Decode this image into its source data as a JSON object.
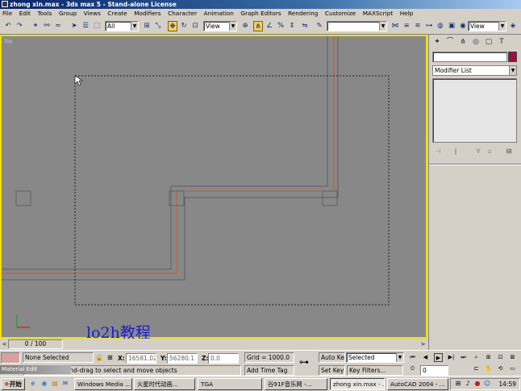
{
  "window": {
    "title": "zhong xin.max - 3ds max 5 - Stand-alone License"
  },
  "menu": {
    "items": [
      "File",
      "Edit",
      "Tools",
      "Group",
      "Views",
      "Create",
      "Modifiers",
      "Character",
      "Animation",
      "Graph Editors",
      "Rendering",
      "Customize",
      "MAXScript",
      "Help"
    ]
  },
  "toolbar": {
    "selection_filter": "All",
    "ref_coord": "View",
    "named_selection": "",
    "right_view": "View"
  },
  "viewport": {
    "label": "Top",
    "watermark": "lo2h教程",
    "border_color": "#f0e000",
    "background": "#888888"
  },
  "command_panel": {
    "object_name": "",
    "object_color": "#9a1040",
    "modifier_list": "Modifier List"
  },
  "timeline": {
    "frame_display": "0 / 100"
  },
  "status": {
    "selection": "None Selected",
    "prompt": "Click or click-and-drag to select and move objects",
    "x_label": "X:",
    "x_value": "16581.02",
    "y_label": "Y:",
    "y_value": "56280.1",
    "z_label": "Z:",
    "z_value": "0.0",
    "grid": "Grid = 1000.0",
    "add_time_tag": "Add Time Tag",
    "auto_key": "Auto Key",
    "auto_key_mode": "Selected",
    "set_key": "Set Key",
    "key_filters": "Key Filters...",
    "current_frame": "0"
  },
  "material_editor": {
    "title": "Material Edit"
  },
  "taskbar": {
    "start_label": "开始",
    "tasks": [
      "Windows Media ...",
      "火星时代动画...",
      "TGA",
      "谷91F音乐网 -...",
      "zhong xin.max - ...",
      "AutoCAD 2004 - ..."
    ],
    "active_task": "zhong xin.max - ...",
    "clock": "14:59"
  }
}
